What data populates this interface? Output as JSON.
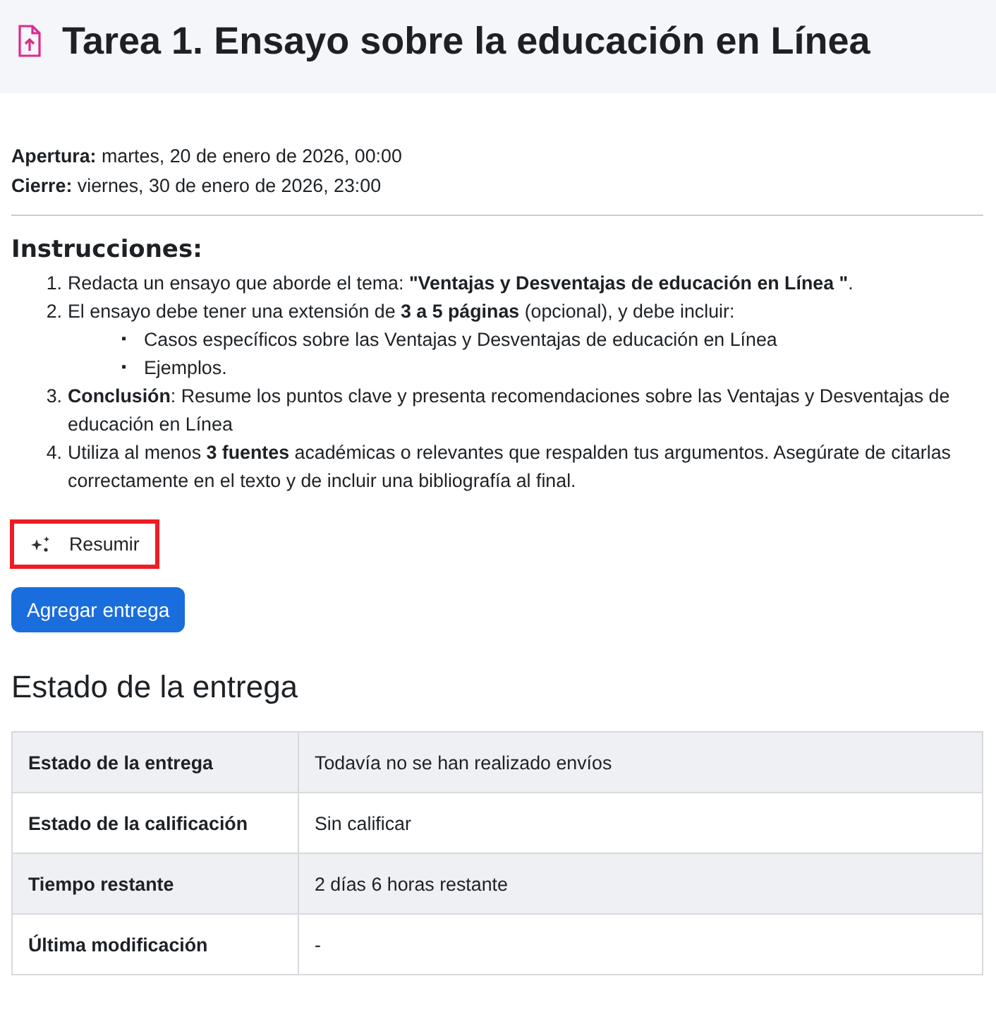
{
  "header": {
    "title": "Tarea 1. Ensayo sobre la educación en Línea"
  },
  "dates": [
    {
      "label": "Apertura:",
      "value": "martes, 20 de enero de 2026, 00:00"
    },
    {
      "label": "Cierre:",
      "value": "viernes, 30 de enero de 2026, 23:00"
    }
  ],
  "instructions": {
    "heading": "Instrucciones:",
    "items": [
      {
        "number": "1.",
        "text": "Redacta un ensayo que aborde el tema: **\"Ventajas y Desventajas de educación en Línea \"**."
      },
      {
        "number": "2.",
        "text": "El ensayo debe tener una extensión de **3 a 5 páginas** (opcional), y debe incluir:",
        "children": [
          {
            "bullet": "▪",
            "text": "Casos específicos sobre las Ventajas y Desventajas de educación en Línea"
          },
          {
            "bullet": "▪",
            "text": "Ejemplos."
          }
        ]
      },
      {
        "number": "3.",
        "text": "**Conclusión**: Resume los puntos clave y presenta recomendaciones  sobre las Ventajas y Desventajas de educación en Línea"
      },
      {
        "number": "4.",
        "text": "Utiliza al menos **3 fuentes** académicas o relevantes que respalden tus argumentos. Asegúrate de citarlas correctamente en el texto y de incluir una bibliografía al final."
      }
    ]
  },
  "summarize_button": {
    "label": "Resumir",
    "highlighted": true
  },
  "submit_button": {
    "label": "Agregar entrega"
  },
  "submission_status": {
    "heading": "Estado de la entrega",
    "rows": [
      {
        "label": "Estado de la entrega",
        "value": "Todavía no se han realizado envíos"
      },
      {
        "label": "Estado de la calificación",
        "value": "Sin calificar"
      },
      {
        "label": "Tiempo restante",
        "value": "2 días 6 horas restante"
      },
      {
        "label": "Última modificación",
        "value": "-"
      }
    ]
  }
}
